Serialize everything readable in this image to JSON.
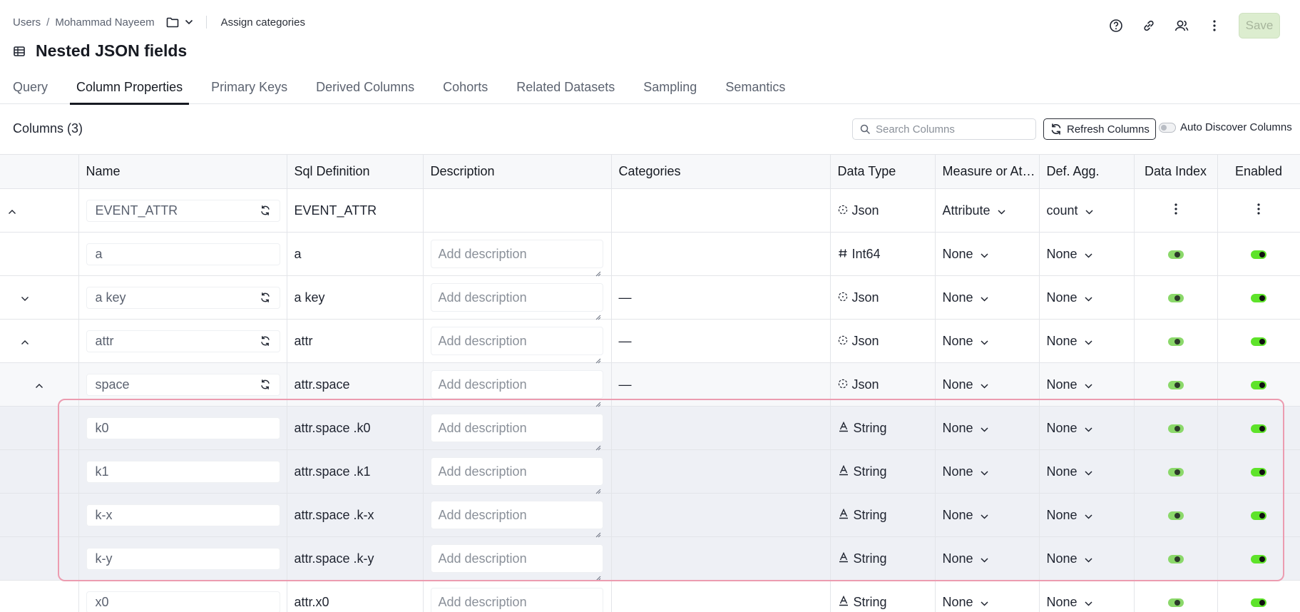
{
  "breadcrumb": {
    "root": "Users",
    "separator": "/",
    "user": "Mohammad Nayeem",
    "assign": "Assign categories"
  },
  "header": {
    "save_label": "Save",
    "title": "Nested JSON fields"
  },
  "tabs": [
    {
      "label": "Query",
      "active": false
    },
    {
      "label": "Column Properties",
      "active": true
    },
    {
      "label": "Primary Keys",
      "active": false
    },
    {
      "label": "Derived Columns",
      "active": false
    },
    {
      "label": "Cohorts",
      "active": false
    },
    {
      "label": "Related Datasets",
      "active": false
    },
    {
      "label": "Sampling",
      "active": false
    },
    {
      "label": "Semantics",
      "active": false
    }
  ],
  "toolbar": {
    "columns_count": "Columns (3)",
    "search_placeholder": "Search Columns",
    "refresh_label": "Refresh Columns",
    "auto_discover_label": "Auto Discover Columns"
  },
  "table": {
    "headers": [
      "Name",
      "Sql Definition",
      "Description",
      "Categories",
      "Data Type",
      "Measure or At…",
      "Def. Agg.",
      "Data Index",
      "Enabled"
    ],
    "rows": [
      {
        "name": "EVENT_ATTR",
        "sql": "EVENT_ATTR",
        "description": "",
        "categories": "",
        "type": "Json",
        "type_icon": "json-icon",
        "measure": "Attribute",
        "agg": "count",
        "expander": "up",
        "sync": true,
        "style": "plain",
        "actions": true
      },
      {
        "name": "a",
        "sql": "a",
        "description": "Add description",
        "categories": "",
        "type": "Int64",
        "type_icon": "hash-icon",
        "measure": "None",
        "agg": "None",
        "expander": "",
        "sync": false,
        "style": "plain",
        "actions": false
      },
      {
        "name": "a key",
        "sql": "a key",
        "description": "Add description",
        "categories": "—",
        "type": "Json",
        "type_icon": "json-icon",
        "measure": "None",
        "agg": "None",
        "expander": "down",
        "sync": true,
        "style": "plain",
        "actions": false
      },
      {
        "name": "attr",
        "sql": "attr",
        "description": "Add description",
        "categories": "—",
        "type": "Json",
        "type_icon": "json-icon",
        "measure": "None",
        "agg": "None",
        "expander": "up",
        "sync": true,
        "style": "plain",
        "actions": false
      },
      {
        "name": "space",
        "sql": "attr.space",
        "description": "Add description",
        "categories": "—",
        "type": "Json",
        "type_icon": "json-icon",
        "measure": "None",
        "agg": "None",
        "expander": "up",
        "sync": true,
        "style": "sub",
        "actions": false
      },
      {
        "name": "k0",
        "sql": "attr.space .k0",
        "description": "Add description",
        "categories": "",
        "type": "String",
        "type_icon": "string-icon",
        "measure": "None",
        "agg": "None",
        "expander": "",
        "sync": false,
        "style": "nested",
        "actions": false
      },
      {
        "name": "k1",
        "sql": "attr.space .k1",
        "description": "Add description",
        "categories": "",
        "type": "String",
        "type_icon": "string-icon",
        "measure": "None",
        "agg": "None",
        "expander": "",
        "sync": false,
        "style": "nested",
        "actions": false
      },
      {
        "name": "k-x",
        "sql": "attr.space .k-x",
        "description": "Add description",
        "categories": "",
        "type": "String",
        "type_icon": "string-icon",
        "measure": "None",
        "agg": "None",
        "expander": "",
        "sync": false,
        "style": "nested",
        "actions": false
      },
      {
        "name": "k-y",
        "sql": "attr.space .k-y",
        "description": "Add description",
        "categories": "",
        "type": "String",
        "type_icon": "string-icon",
        "measure": "None",
        "agg": "None",
        "expander": "",
        "sync": false,
        "style": "nested",
        "actions": false
      },
      {
        "name": "x0",
        "sql": "attr.x0",
        "description": "Add description",
        "categories": "",
        "type": "String",
        "type_icon": "string-icon",
        "measure": "None",
        "agg": "None",
        "expander": "",
        "sync": false,
        "style": "plain",
        "actions": false
      }
    ]
  }
}
